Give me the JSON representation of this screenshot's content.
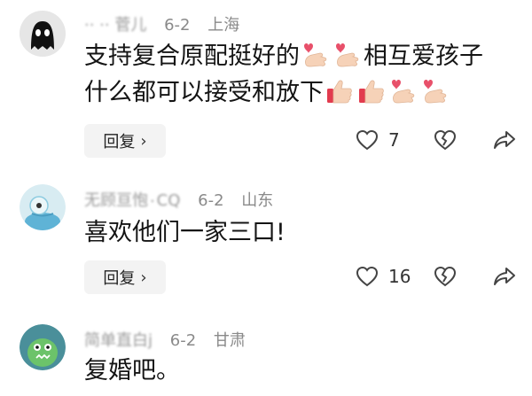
{
  "comments": [
    {
      "name": "·· ·· 菅儿",
      "date": "6-2",
      "location": "上海",
      "line1": "支持复合原配挺好的",
      "line1b": "相互爱孩子",
      "line2": "什么都可以接受和放下",
      "reply_label": "回复",
      "like_count": "7",
      "avatar_icon": "ghost-avatar"
    },
    {
      "name": "无顾亘怉۰CQ",
      "date": "6-2",
      "location": "山东",
      "line1": "喜欢他们一家三口!",
      "reply_label": "回复",
      "like_count": "16",
      "avatar_icon": "cartoon-avatar"
    },
    {
      "name": "简单直白j",
      "date": "6-2",
      "location": "甘肃",
      "line1": "复婚吧。",
      "avatar_icon": "green-monster-avatar"
    }
  ],
  "icons": {
    "heart": "heart-outline-icon",
    "broken_heart": "broken-heart-icon",
    "share": "share-arrow-icon",
    "finger_heart": "finger-heart-emoji",
    "thumbs_up": "thumbs-up-emoji"
  }
}
